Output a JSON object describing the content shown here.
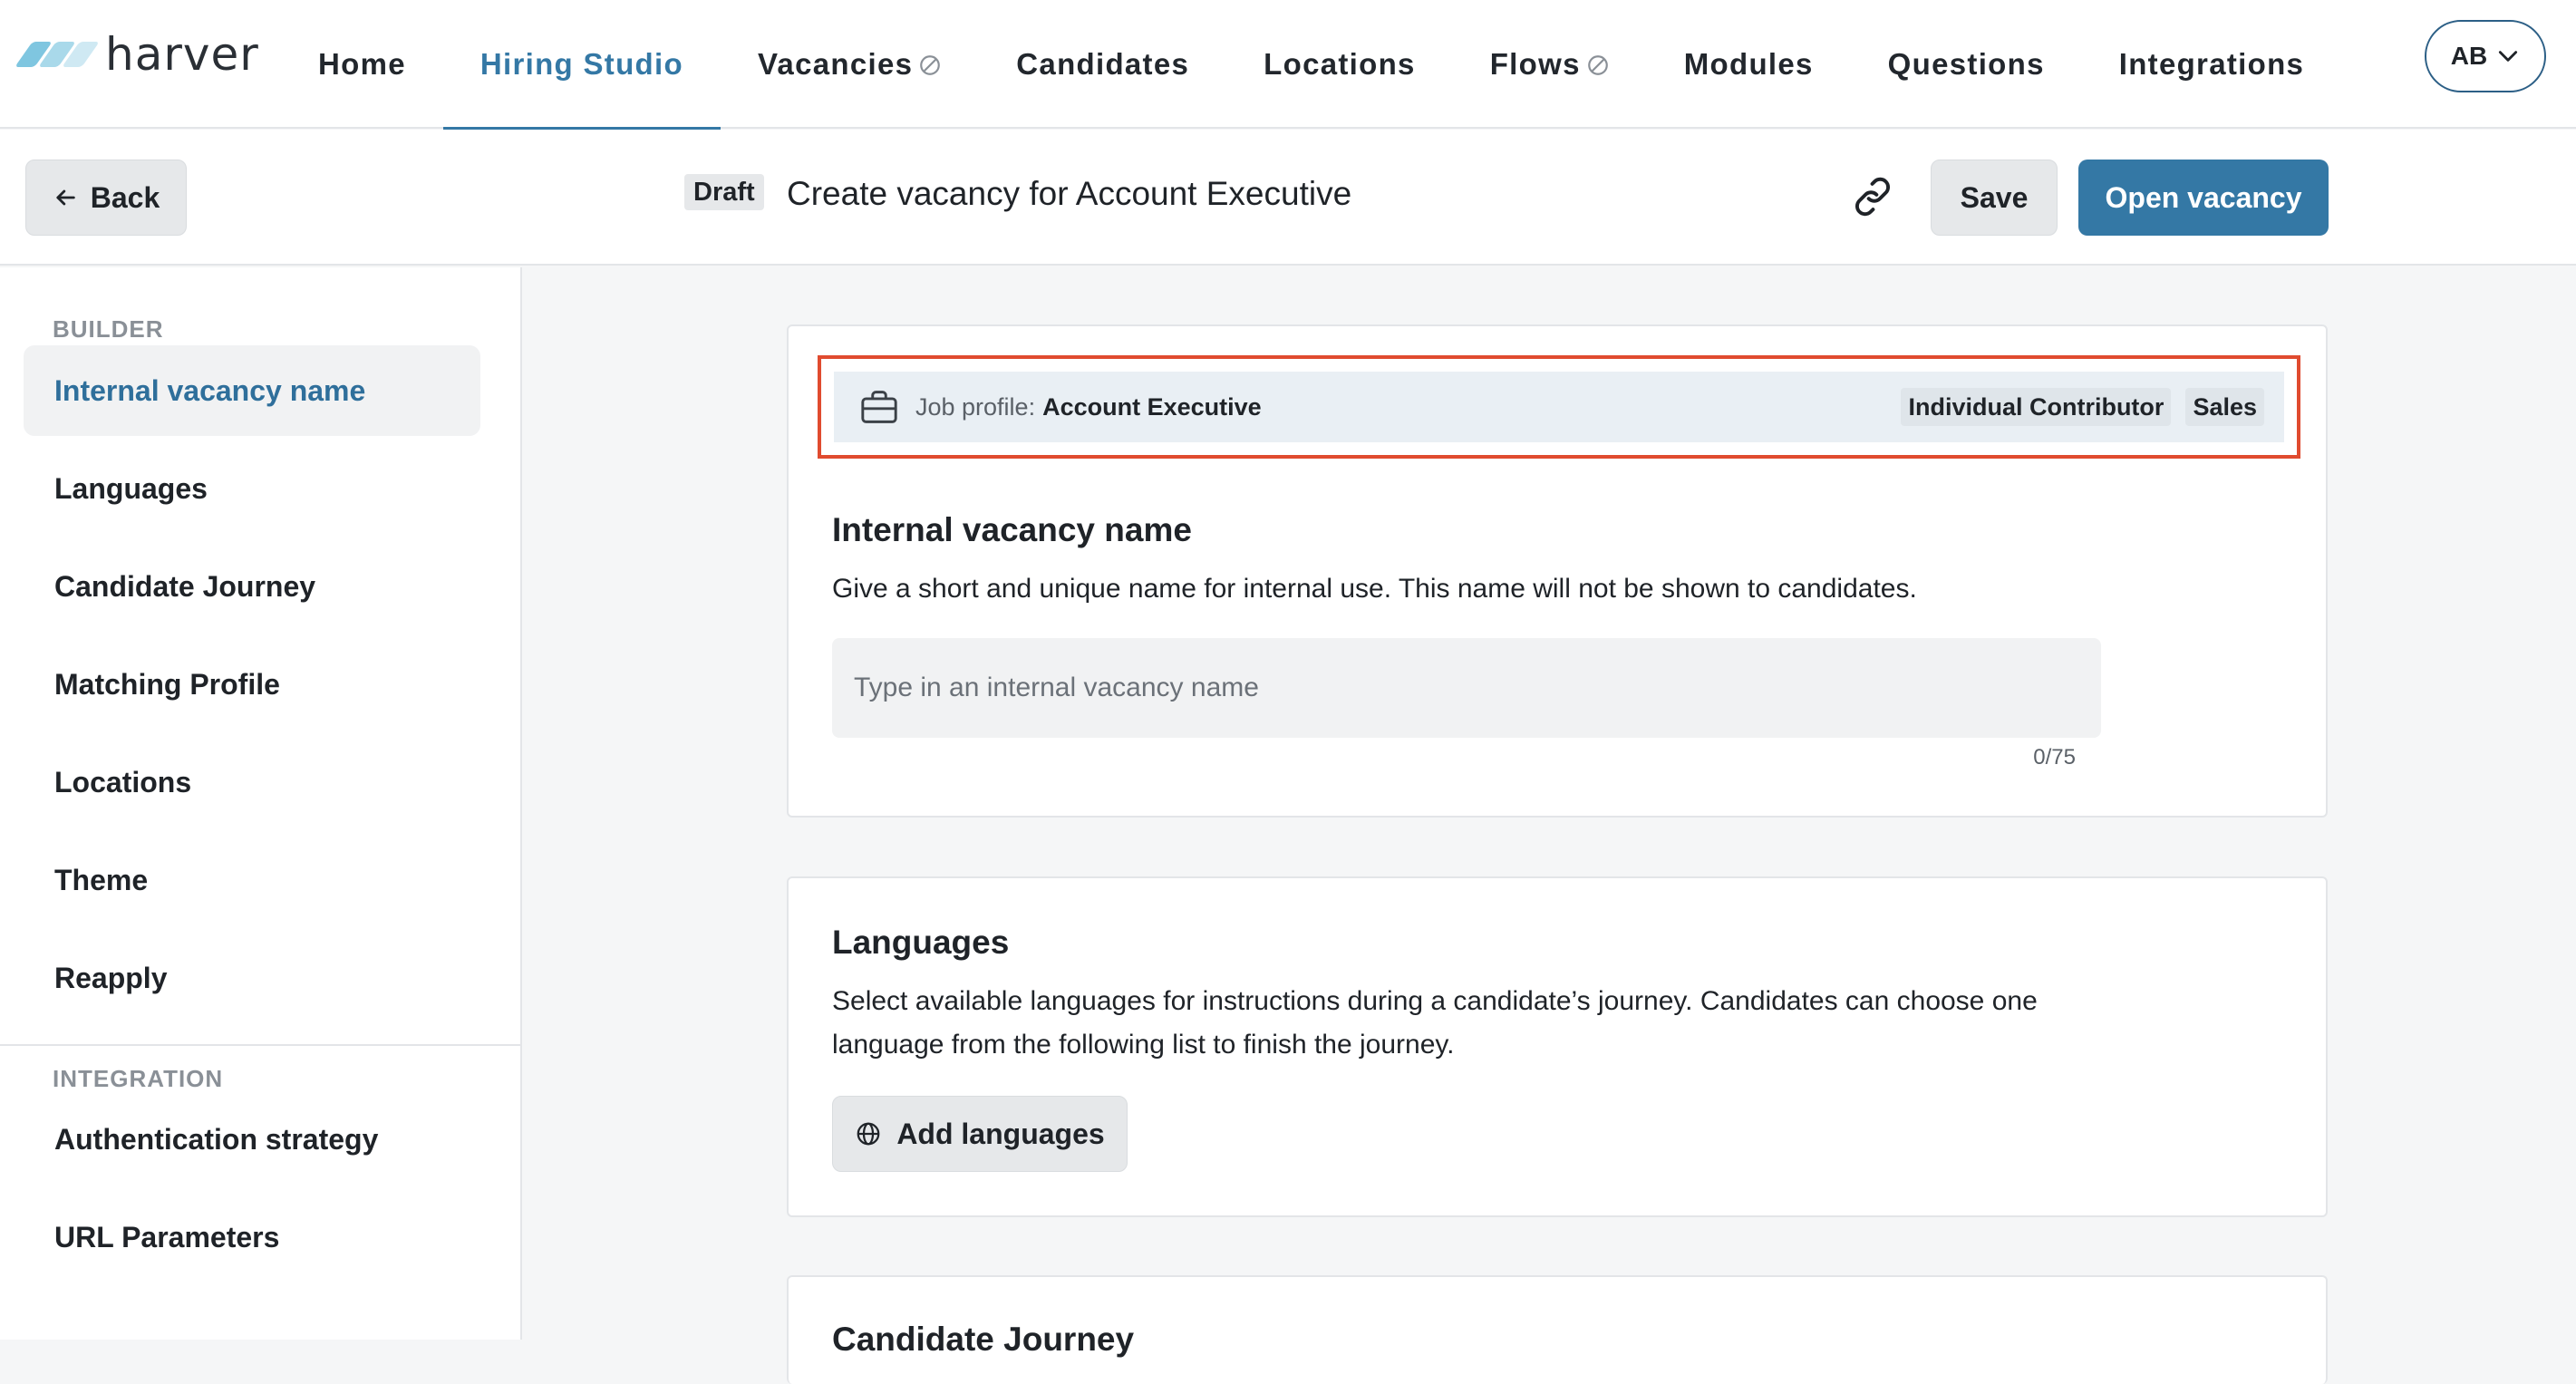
{
  "brand": {
    "name": "harver",
    "logo_colors": [
      "#7fc6e0",
      "#a9d9ea",
      "#cfe9f3"
    ]
  },
  "nav": {
    "items": [
      {
        "label": "Home",
        "active": false,
        "restricted": false
      },
      {
        "label": "Hiring Studio",
        "active": true,
        "restricted": false
      },
      {
        "label": "Vacancies",
        "active": false,
        "restricted": true
      },
      {
        "label": "Candidates",
        "active": false,
        "restricted": false
      },
      {
        "label": "Locations",
        "active": false,
        "restricted": false
      },
      {
        "label": "Flows",
        "active": false,
        "restricted": true
      },
      {
        "label": "Modules",
        "active": false,
        "restricted": false
      },
      {
        "label": "Questions",
        "active": false,
        "restricted": false
      },
      {
        "label": "Integrations",
        "active": false,
        "restricted": false
      }
    ],
    "user_initials": "AB"
  },
  "header": {
    "back_label": "Back",
    "status_badge": "Draft",
    "title": "Create vacancy for Account Executive",
    "save_label": "Save",
    "open_label": "Open vacancy"
  },
  "sidebar": {
    "builder_title": "BUILDER",
    "builder_items": [
      {
        "label": "Internal vacancy name",
        "active": true
      },
      {
        "label": "Languages",
        "active": false
      },
      {
        "label": "Candidate Journey",
        "active": false
      },
      {
        "label": "Matching Profile",
        "active": false
      },
      {
        "label": "Locations",
        "active": false
      },
      {
        "label": "Theme",
        "active": false
      },
      {
        "label": "Reapply",
        "active": false
      }
    ],
    "integration_title": "INTEGRATION",
    "integration_items": [
      {
        "label": "Authentication strategy"
      },
      {
        "label": "URL Parameters"
      }
    ]
  },
  "job_profile": {
    "label": "Job profile:",
    "value": "Account Executive",
    "tags": [
      "Individual Contributor",
      "Sales"
    ]
  },
  "internal_name": {
    "heading": "Internal vacancy name",
    "description": "Give a short and unique name for internal use. This name will not be shown to candidates.",
    "placeholder": "Type in an internal vacancy name",
    "value": "",
    "counter": "0/75"
  },
  "languages": {
    "heading": "Languages",
    "description_line1": "Select available languages for instructions during a candidate’s journey. Candidates can choose one",
    "description_line2": "language from the following list to finish the journey.",
    "add_label": "Add languages"
  },
  "candidate_journey": {
    "heading": "Candidate Journey"
  },
  "colors": {
    "accent": "#3478a5",
    "highlight_border": "#e04b2f"
  }
}
